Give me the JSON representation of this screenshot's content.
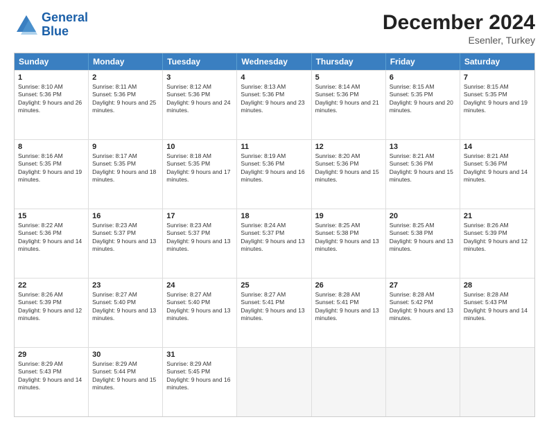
{
  "header": {
    "logo_line1": "General",
    "logo_line2": "Blue",
    "title": "December 2024",
    "subtitle": "Esenler, Turkey"
  },
  "calendar": {
    "headers": [
      "Sunday",
      "Monday",
      "Tuesday",
      "Wednesday",
      "Thursday",
      "Friday",
      "Saturday"
    ],
    "rows": [
      [
        {
          "day": "1",
          "rise": "8:10 AM",
          "set": "5:36 PM",
          "daylight": "9 hours and 26 minutes."
        },
        {
          "day": "2",
          "rise": "8:11 AM",
          "set": "5:36 PM",
          "daylight": "9 hours and 25 minutes."
        },
        {
          "day": "3",
          "rise": "8:12 AM",
          "set": "5:36 PM",
          "daylight": "9 hours and 24 minutes."
        },
        {
          "day": "4",
          "rise": "8:13 AM",
          "set": "5:36 PM",
          "daylight": "9 hours and 23 minutes."
        },
        {
          "day": "5",
          "rise": "8:14 AM",
          "set": "5:36 PM",
          "daylight": "9 hours and 21 minutes."
        },
        {
          "day": "6",
          "rise": "8:15 AM",
          "set": "5:35 PM",
          "daylight": "9 hours and 20 minutes."
        },
        {
          "day": "7",
          "rise": "8:15 AM",
          "set": "5:35 PM",
          "daylight": "9 hours and 19 minutes."
        }
      ],
      [
        {
          "day": "8",
          "rise": "8:16 AM",
          "set": "5:35 PM",
          "daylight": "9 hours and 19 minutes."
        },
        {
          "day": "9",
          "rise": "8:17 AM",
          "set": "5:35 PM",
          "daylight": "9 hours and 18 minutes."
        },
        {
          "day": "10",
          "rise": "8:18 AM",
          "set": "5:35 PM",
          "daylight": "9 hours and 17 minutes."
        },
        {
          "day": "11",
          "rise": "8:19 AM",
          "set": "5:36 PM",
          "daylight": "9 hours and 16 minutes."
        },
        {
          "day": "12",
          "rise": "8:20 AM",
          "set": "5:36 PM",
          "daylight": "9 hours and 15 minutes."
        },
        {
          "day": "13",
          "rise": "8:21 AM",
          "set": "5:36 PM",
          "daylight": "9 hours and 15 minutes."
        },
        {
          "day": "14",
          "rise": "8:21 AM",
          "set": "5:36 PM",
          "daylight": "9 hours and 14 minutes."
        }
      ],
      [
        {
          "day": "15",
          "rise": "8:22 AM",
          "set": "5:36 PM",
          "daylight": "9 hours and 14 minutes."
        },
        {
          "day": "16",
          "rise": "8:23 AM",
          "set": "5:37 PM",
          "daylight": "9 hours and 13 minutes."
        },
        {
          "day": "17",
          "rise": "8:23 AM",
          "set": "5:37 PM",
          "daylight": "9 hours and 13 minutes."
        },
        {
          "day": "18",
          "rise": "8:24 AM",
          "set": "5:37 PM",
          "daylight": "9 hours and 13 minutes."
        },
        {
          "day": "19",
          "rise": "8:25 AM",
          "set": "5:38 PM",
          "daylight": "9 hours and 13 minutes."
        },
        {
          "day": "20",
          "rise": "8:25 AM",
          "set": "5:38 PM",
          "daylight": "9 hours and 13 minutes."
        },
        {
          "day": "21",
          "rise": "8:26 AM",
          "set": "5:39 PM",
          "daylight": "9 hours and 12 minutes."
        }
      ],
      [
        {
          "day": "22",
          "rise": "8:26 AM",
          "set": "5:39 PM",
          "daylight": "9 hours and 12 minutes."
        },
        {
          "day": "23",
          "rise": "8:27 AM",
          "set": "5:40 PM",
          "daylight": "9 hours and 13 minutes."
        },
        {
          "day": "24",
          "rise": "8:27 AM",
          "set": "5:40 PM",
          "daylight": "9 hours and 13 minutes."
        },
        {
          "day": "25",
          "rise": "8:27 AM",
          "set": "5:41 PM",
          "daylight": "9 hours and 13 minutes."
        },
        {
          "day": "26",
          "rise": "8:28 AM",
          "set": "5:41 PM",
          "daylight": "9 hours and 13 minutes."
        },
        {
          "day": "27",
          "rise": "8:28 AM",
          "set": "5:42 PM",
          "daylight": "9 hours and 13 minutes."
        },
        {
          "day": "28",
          "rise": "8:28 AM",
          "set": "5:43 PM",
          "daylight": "9 hours and 14 minutes."
        }
      ],
      [
        {
          "day": "29",
          "rise": "8:29 AM",
          "set": "5:43 PM",
          "daylight": "9 hours and 14 minutes."
        },
        {
          "day": "30",
          "rise": "8:29 AM",
          "set": "5:44 PM",
          "daylight": "9 hours and 15 minutes."
        },
        {
          "day": "31",
          "rise": "8:29 AM",
          "set": "5:45 PM",
          "daylight": "9 hours and 16 minutes."
        },
        null,
        null,
        null,
        null
      ]
    ]
  }
}
